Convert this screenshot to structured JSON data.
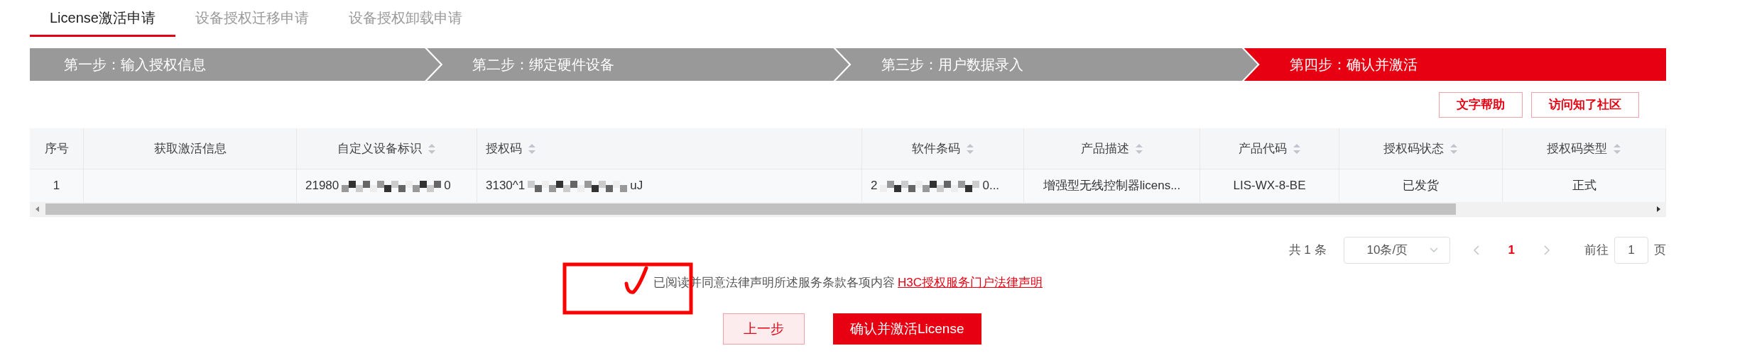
{
  "tabs": [
    {
      "label": "License激活申请",
      "selected": true
    },
    {
      "label": "设备授权迁移申请",
      "selected": false
    },
    {
      "label": "设备授权卸载申请",
      "selected": false
    }
  ],
  "steps": [
    {
      "label": "第一步：输入授权信息",
      "selected": false
    },
    {
      "label": "第二步：绑定硬件设备",
      "selected": false
    },
    {
      "label": "第三步：用户数据录入",
      "selected": false
    },
    {
      "label": "第四步：确认并激活",
      "selected": true
    }
  ],
  "help_buttons": [
    "文字帮助",
    "访问知了社区"
  ],
  "table": {
    "columns": [
      {
        "label": "序号",
        "sortable": false
      },
      {
        "label": "获取激活信息",
        "sortable": false
      },
      {
        "label": "自定义设备标识",
        "sortable": true
      },
      {
        "label": "授权码",
        "sortable": true
      },
      {
        "label": "软件条码",
        "sortable": true
      },
      {
        "label": "产品描述",
        "sortable": true
      },
      {
        "label": "产品代码",
        "sortable": true
      },
      {
        "label": "授权码状态",
        "sortable": true
      },
      {
        "label": "授权码类型",
        "sortable": true
      }
    ],
    "rows": [
      {
        "cells": [
          {
            "text": "1"
          },
          {},
          {
            "start": "21980",
            "end": "0",
            "redacted": true
          },
          {
            "start": "3130^1",
            "end": "uJ",
            "redacted": true
          },
          {
            "start": "2",
            "end": "0...",
            "redacted": true
          },
          {
            "text": "增强型无线控制器licens..."
          },
          {
            "text": "LIS-WX-8-BE"
          },
          {
            "text": "已发货"
          },
          {
            "text": "正式"
          }
        ]
      }
    ]
  },
  "pagination": {
    "total": "共 1 条",
    "page_size": "10条/页",
    "current_page": "1",
    "goto_label": "前往",
    "goto_value": "1",
    "goto_suffix": "页"
  },
  "agreement": {
    "text": "已阅读并同意法律声明所述服务条款各项内容",
    "link": "H3C授权服务门户法律声明"
  },
  "actions": [
    {
      "label": "上一步",
      "kind": "secondary"
    },
    {
      "label": "确认并激活License",
      "kind": "primary"
    }
  ]
}
